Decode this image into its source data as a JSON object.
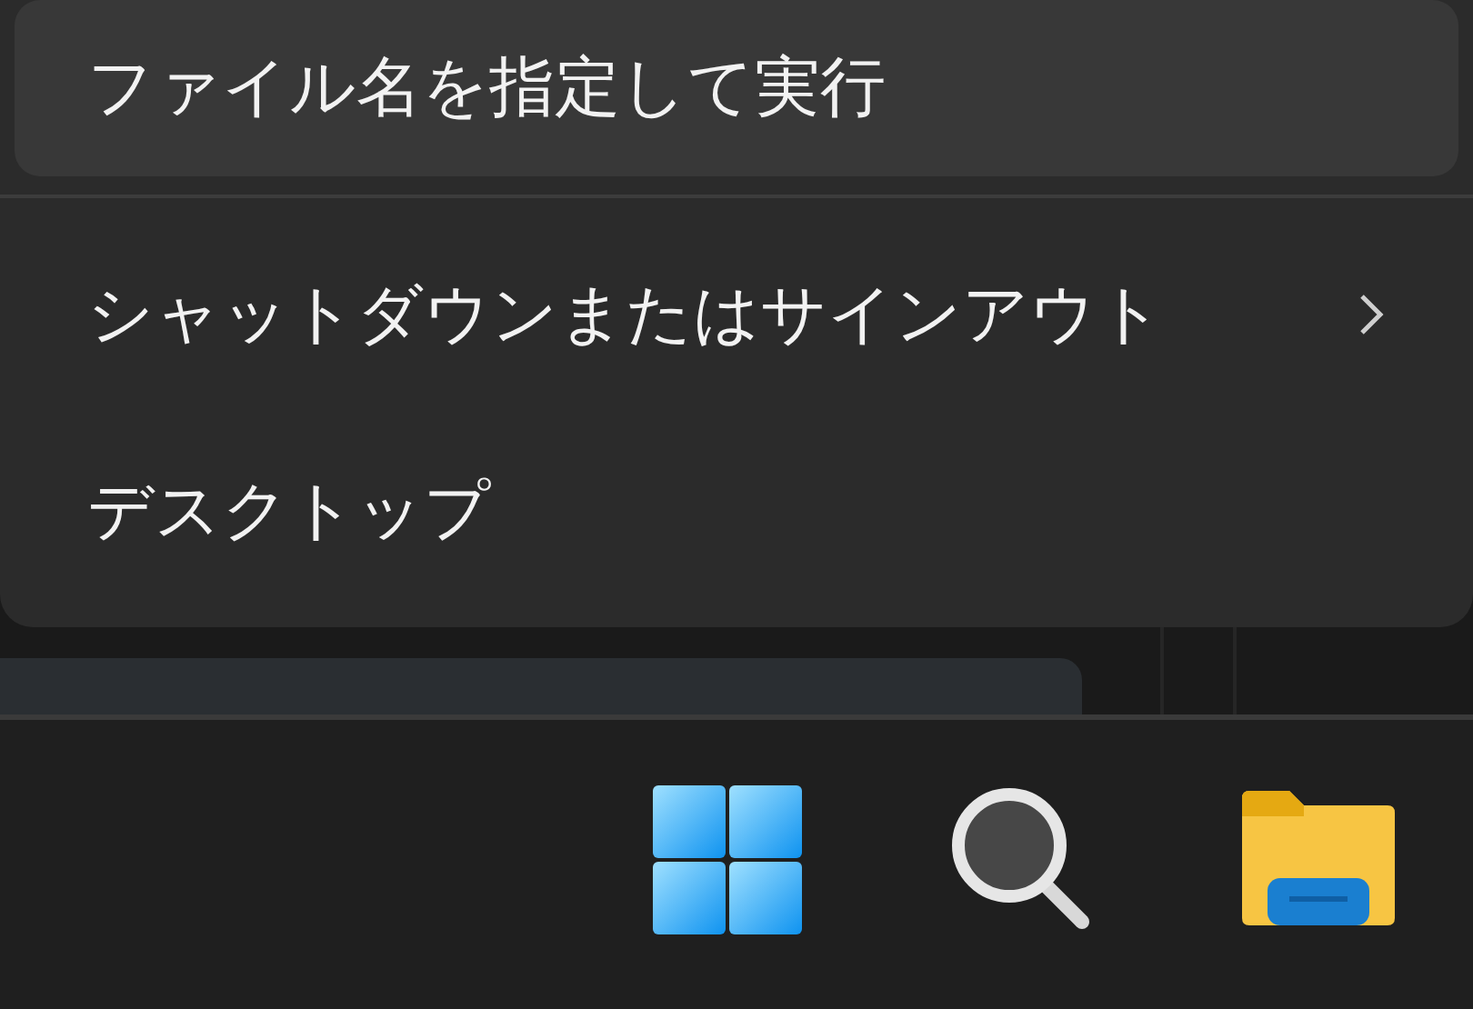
{
  "context_menu": {
    "items": [
      {
        "label": "ファイル名を指定して実行",
        "highlighted": true,
        "has_submenu": false,
        "divider_after": true
      },
      {
        "label": "シャットダウンまたはサインアウト",
        "highlighted": false,
        "has_submenu": true,
        "divider_after": false
      },
      {
        "label": "デスクトップ",
        "highlighted": false,
        "has_submenu": false,
        "divider_after": false
      }
    ]
  },
  "taskbar": {
    "buttons": [
      {
        "kind": "start"
      },
      {
        "kind": "search"
      },
      {
        "kind": "explorer"
      }
    ]
  }
}
